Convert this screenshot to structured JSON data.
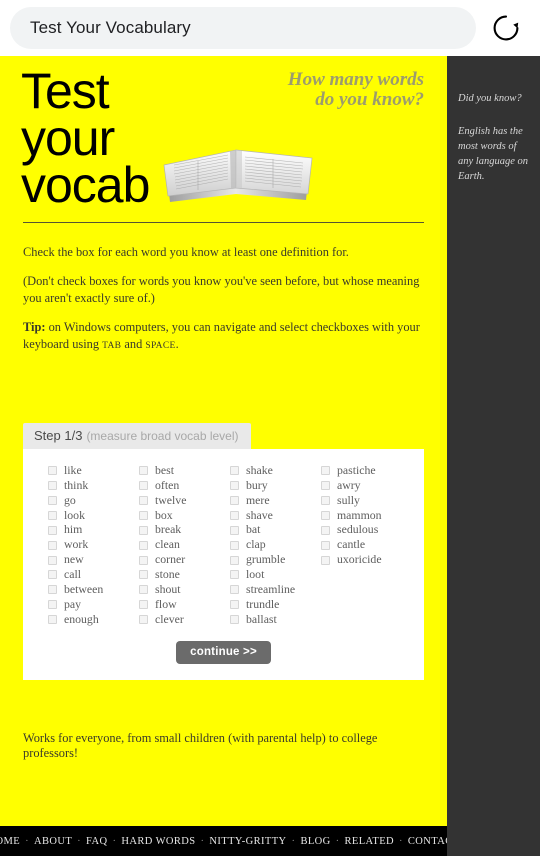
{
  "browser": {
    "url_text": "Test Your Vocabulary",
    "url_placeholder": "Search or type URL",
    "reload_icon": "reload-icon"
  },
  "masthead": {
    "title_line1": "Test",
    "title_line2": "your",
    "title_line3": "vocab",
    "tagline_line1": "How many words",
    "tagline_line2": "do you know?",
    "book_image_alt": "open-dictionary-image"
  },
  "intro": {
    "line1": "Check the box for each word you know at least one definition for.",
    "line2": "(Don't check boxes for words you know you've seen before, but whose meaning you aren't exactly sure of.)",
    "tip_label": "Tip:",
    "tip_text_a": " on Windows computers, you can navigate and select checkboxes with your keyboard using ",
    "tip_key1": "TAB",
    "tip_text_b": " and ",
    "tip_key2": "SPACE",
    "tip_text_c": "."
  },
  "quiz": {
    "step_label": "Step 1/3",
    "step_sublabel": "(measure broad vocab level)",
    "continue_label": "continue >>",
    "columns": [
      [
        "like",
        "think",
        "go",
        "look",
        "him",
        "work",
        "new",
        "call",
        "between",
        "pay"
      ],
      [
        "enough",
        "best",
        "often",
        "twelve",
        "box",
        "break",
        "clean",
        "corner",
        "stone",
        "shout"
      ],
      [
        "flow",
        "clever",
        "shake",
        "bury",
        "mere",
        "shave",
        "bat",
        "clap",
        "grumble",
        "loot"
      ],
      [
        "streamline",
        "trundle",
        "ballast",
        "pastiche",
        "awry",
        "sully",
        "mammon",
        "sedulous",
        "cantle",
        "uxoricide"
      ]
    ]
  },
  "closing": {
    "note": "Works for everyone, from small children (with parental help) to college professors!"
  },
  "sidebar": {
    "heading": "Did you know?",
    "body": "English has the most words of any language on Earth."
  },
  "footer": {
    "links": [
      "HOME",
      "ABOUT",
      "FAQ",
      "HARD WORDS",
      "NITTY-GRITTY",
      "BLOG",
      "RELATED",
      "CONTACT"
    ],
    "separator": "·"
  },
  "colors": {
    "page_yellow": "#ffff00",
    "sidebar_dark": "#333333",
    "footer_black": "#000000",
    "tagline_olive": "#9c9c6e",
    "button_gray": "#6b6b6b"
  }
}
